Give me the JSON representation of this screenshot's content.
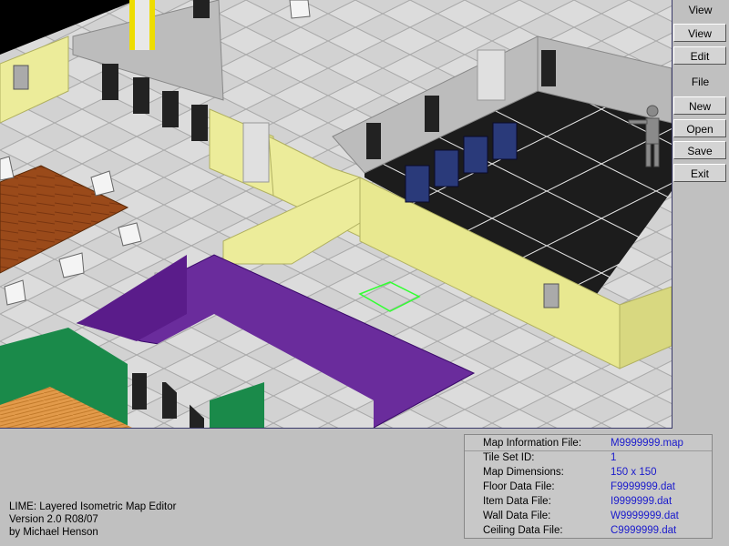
{
  "menu": {
    "view_header": "View",
    "view_buttons": [
      "View",
      "Edit"
    ],
    "file_header": "File",
    "file_buttons": [
      "New",
      "Open",
      "Save",
      "Exit"
    ]
  },
  "info_panel": {
    "rows": [
      {
        "label": "Map Information File:",
        "value": "M9999999.map"
      },
      {
        "label": "Tile Set ID:",
        "value": "1"
      },
      {
        "label": "Map Dimensions:",
        "value": "150 x 150"
      },
      {
        "label": "Floor Data File:",
        "value": "F9999999.dat"
      },
      {
        "label": "Item Data File:",
        "value": "I9999999.dat"
      },
      {
        "label": "Wall Data File:",
        "value": "W9999999.dat"
      },
      {
        "label": "Ceiling Data File:",
        "value": "C9999999.dat"
      }
    ]
  },
  "credits": {
    "line1": "LIME:  Layered Isometric Map Editor",
    "line2": "Version 2.0 R08/07",
    "line3": "by Michael Henson"
  },
  "colors": {
    "floor_tile": "#d6d6d6",
    "yellow_wall": "#ecec9a",
    "purple_wall": "#6a2c9c",
    "green_wall": "#1a8a4a",
    "wood_table": "#9a4a1a",
    "black_floor": "#1c1c1c",
    "selection": "#33ff33",
    "info_value": "#1a1acc"
  }
}
